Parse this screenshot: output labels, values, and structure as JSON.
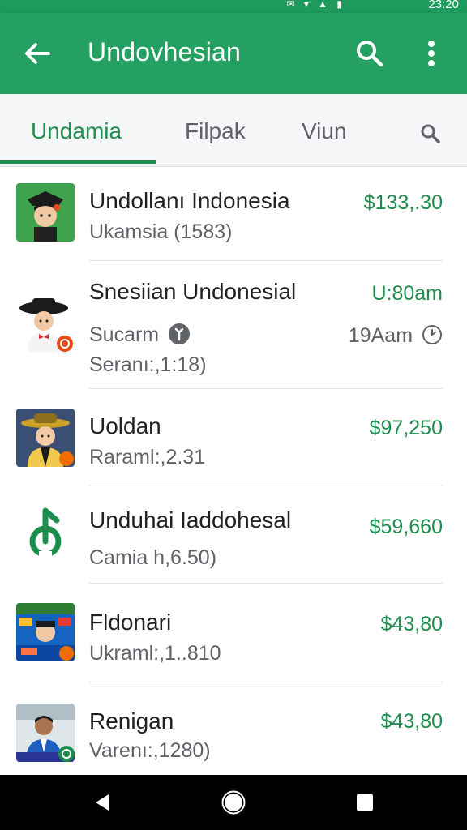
{
  "status_bar": {
    "time": "23:20",
    "icons": [
      "notification-icon",
      "wifi-icon",
      "signal-icon",
      "battery-icon"
    ]
  },
  "app_bar": {
    "title": "Undovhesian",
    "icons": [
      "back-arrow-icon",
      "search-icon",
      "more-vert-icon"
    ]
  },
  "tabs": {
    "items": [
      {
        "label": "Undamia",
        "active": true
      },
      {
        "label": "Filpak",
        "active": false
      },
      {
        "label": "Viun",
        "active": false
      }
    ]
  },
  "list": {
    "items": [
      {
        "name": "Undollanı Indonesia",
        "sub": "Ukamsia (1583)",
        "price": "$133,.30"
      },
      {
        "name": "Snesiian Undonesial",
        "time": "U:80am",
        "sub": "Sucarm",
        "sub2": "Seranı:,1:18)",
        "meta": "19Aam"
      },
      {
        "name": "Uoldan",
        "sub": "Raraml:,2.31",
        "price": "$97,250"
      },
      {
        "name": "Unduhai Iaddohesal",
        "sub": "Camia h,6.50)",
        "price": "$59,660"
      },
      {
        "name": "Fldonari",
        "sub": "Ukraml:,1..810",
        "price": "$43,80"
      },
      {
        "name": "Renigan",
        "sub": "Varenı:,1280)",
        "price": "$43,80"
      }
    ]
  },
  "colors": {
    "primary": "#23a062",
    "accent_text": "#1e8e4e",
    "tab_background": "#f5f6f7",
    "nav_bar": "#000000"
  }
}
